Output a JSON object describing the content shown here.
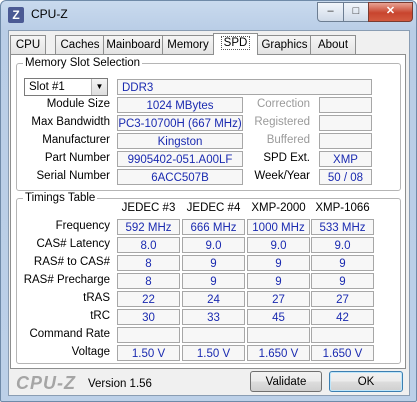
{
  "window": {
    "title": "CPU-Z",
    "app_icon": "Z",
    "controls": {
      "minimize": "–",
      "maximize": "□",
      "close": "✕"
    }
  },
  "tabs": [
    {
      "label": "CPU"
    },
    {
      "label": "Caches"
    },
    {
      "label": "Mainboard"
    },
    {
      "label": "Memory"
    },
    {
      "label": "SPD",
      "active": true
    },
    {
      "label": "Graphics"
    },
    {
      "label": "About"
    }
  ],
  "slot": {
    "legend": "Memory Slot Selection",
    "selected": "Slot #1",
    "type": "DDR3",
    "module_size_label": "Module Size",
    "module_size": "1024 MBytes",
    "max_bandwidth_label": "Max Bandwidth",
    "max_bandwidth": "PC3-10700H (667 MHz)",
    "manufacturer_label": "Manufacturer",
    "manufacturer": "Kingston",
    "part_number_label": "Part Number",
    "part_number": "9905402-051.A00LF",
    "serial_number_label": "Serial Number",
    "serial_number": "6ACC507B",
    "correction_label": "Correction",
    "registered_label": "Registered",
    "buffered_label": "Buffered",
    "spd_ext_label": "SPD Ext.",
    "spd_ext": "XMP",
    "week_year_label": "Week/Year",
    "week_year": "50 / 08"
  },
  "timings": {
    "legend": "Timings Table",
    "columns": [
      "JEDEC #3",
      "JEDEC #4",
      "XMP-2000",
      "XMP-1066"
    ],
    "rows": [
      {
        "label": "Frequency",
        "values": [
          "592 MHz",
          "666 MHz",
          "1000 MHz",
          "533 MHz"
        ]
      },
      {
        "label": "CAS# Latency",
        "values": [
          "8.0",
          "9.0",
          "9.0",
          "9.0"
        ]
      },
      {
        "label": "RAS# to CAS#",
        "values": [
          "8",
          "9",
          "9",
          "9"
        ]
      },
      {
        "label": "RAS# Precharge",
        "values": [
          "8",
          "9",
          "9",
          "9"
        ]
      },
      {
        "label": "tRAS",
        "values": [
          "22",
          "24",
          "27",
          "27"
        ]
      },
      {
        "label": "tRC",
        "values": [
          "30",
          "33",
          "45",
          "42"
        ]
      },
      {
        "label": "Command Rate",
        "values": [
          "",
          "",
          "",
          ""
        ]
      },
      {
        "label": "Voltage",
        "values": [
          "1.50 V",
          "1.50 V",
          "1.650 V",
          "1.650 V"
        ]
      }
    ]
  },
  "footer": {
    "logo": "CPU-Z",
    "version": "Version 1.56",
    "validate_label": "Validate",
    "ok_label": "OK"
  }
}
